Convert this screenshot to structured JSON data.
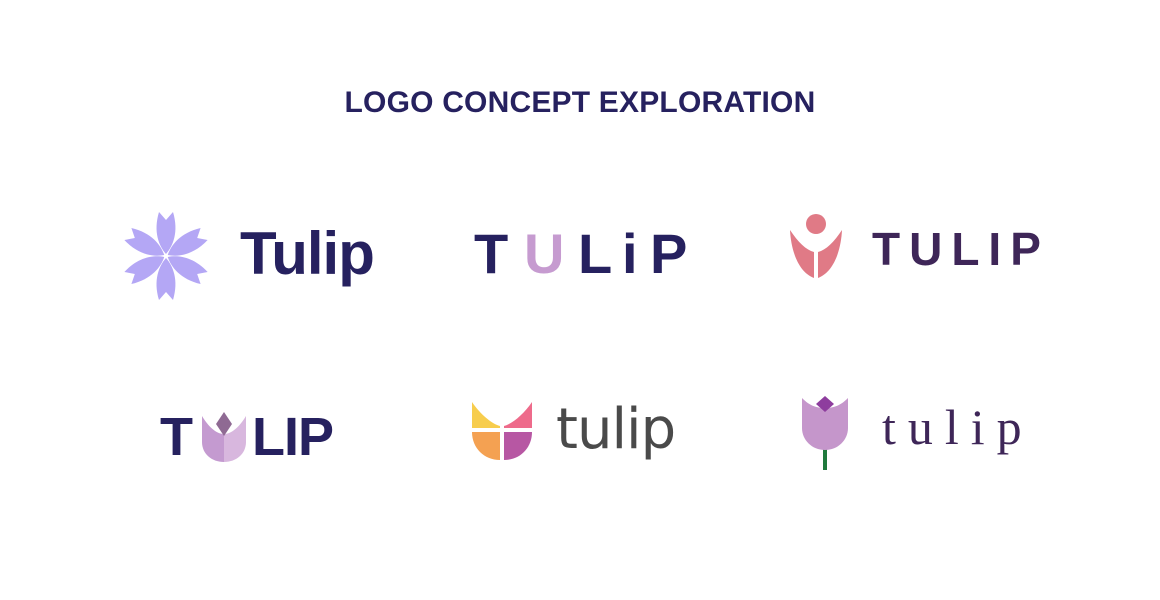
{
  "header": {
    "title": "LOGO CONCEPT EXPLORATION"
  },
  "logos": [
    {
      "wordmark": "Tulip",
      "icon": "six-petal-flower-icon",
      "colors": {
        "text": "#26215f",
        "icon": "#b4a7f5"
      }
    },
    {
      "letters": [
        "T",
        "U",
        "L",
        "i",
        "P"
      ],
      "icon": "none",
      "colors": {
        "text": "#26215f",
        "accent": "#c69bd0"
      }
    },
    {
      "wordmark": "TULIP",
      "icon": "person-tulip-icon",
      "colors": {
        "text": "#3e2658",
        "icon": "#e07a86"
      }
    },
    {
      "letters": [
        "T",
        "LIP"
      ],
      "icon": "tulip-letter-u-icon",
      "colors": {
        "text": "#26215f",
        "icon": "#c49ad0"
      }
    },
    {
      "wordmark": "tulip",
      "icon": "four-color-tulip-icon",
      "colors": {
        "text": "#4a4a4a",
        "yellow": "#f7cd4d",
        "pink": "#ee6b8b",
        "orange": "#f4a152",
        "magenta": "#b757a3"
      }
    },
    {
      "wordmark": "tulip",
      "icon": "tulip-flower-stem-icon",
      "colors": {
        "text": "#3e2658",
        "petal": "#c596cb",
        "bud": "#8e3d9e",
        "stem": "#1f7a3d"
      }
    }
  ]
}
